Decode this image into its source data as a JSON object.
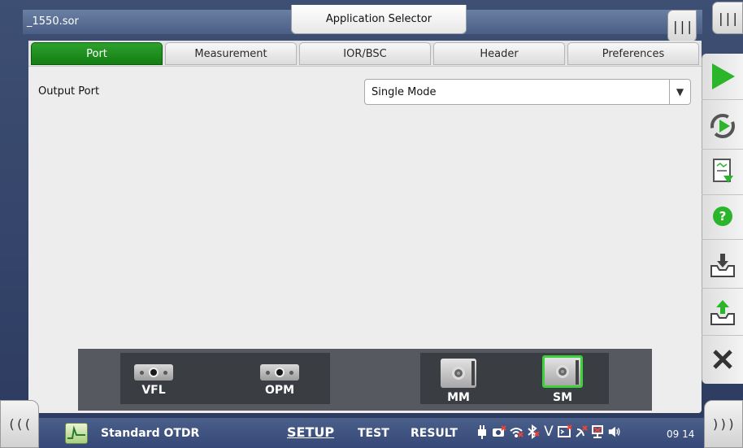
{
  "window": {
    "file_name": "_1550.sor",
    "app_selector_label": "Application Selector",
    "corner_left_icon": "panel-menu-icon",
    "corner_right_icon": "panel-menu-icon",
    "corner_glyph": "|||"
  },
  "tabs": [
    {
      "label": "Port",
      "active": true
    },
    {
      "label": "Measurement",
      "active": false
    },
    {
      "label": "IOR/BSC",
      "active": false
    },
    {
      "label": "Header",
      "active": false
    },
    {
      "label": "Preferences",
      "active": false
    }
  ],
  "settings": {
    "output_port_label": "Output Port",
    "output_port_value": "Single Mode"
  },
  "ports": [
    {
      "label": "VFL",
      "selected": false
    },
    {
      "label": "OPM",
      "selected": false
    },
    {
      "label": "MM",
      "selected": false
    },
    {
      "label": "SM",
      "selected": true
    }
  ],
  "right_toolbar": [
    {
      "icon": "play-icon"
    },
    {
      "icon": "refresh-play-icon"
    },
    {
      "icon": "report-icon"
    },
    {
      "icon": "help-icon"
    },
    {
      "icon": "save-icon"
    },
    {
      "icon": "open-icon"
    },
    {
      "icon": "close-icon"
    }
  ],
  "bottom_bar": {
    "left_glyph": "(((",
    "right_glyph": ")))",
    "app_name": "Standard OTDR",
    "nav": [
      {
        "label": "SETUP",
        "active": true
      },
      {
        "label": "TEST",
        "active": false
      },
      {
        "label": "RESULT",
        "active": false
      }
    ],
    "status_icons": [
      "power-plug-icon",
      "camera-disabled-icon",
      "wifi-disabled-icon",
      "bluetooth-disabled-icon",
      "v-icon",
      "remote-disabled-icon",
      "satellite-disabled-icon",
      "network-disabled-icon",
      "speaker-icon"
    ],
    "v_glyph": "V",
    "clock": "09 14"
  },
  "colors": {
    "accent_green": "#1a8f1a",
    "play_green": "#2bb52b",
    "selection_green": "#3ed13e",
    "background_blue": "#34446a"
  }
}
